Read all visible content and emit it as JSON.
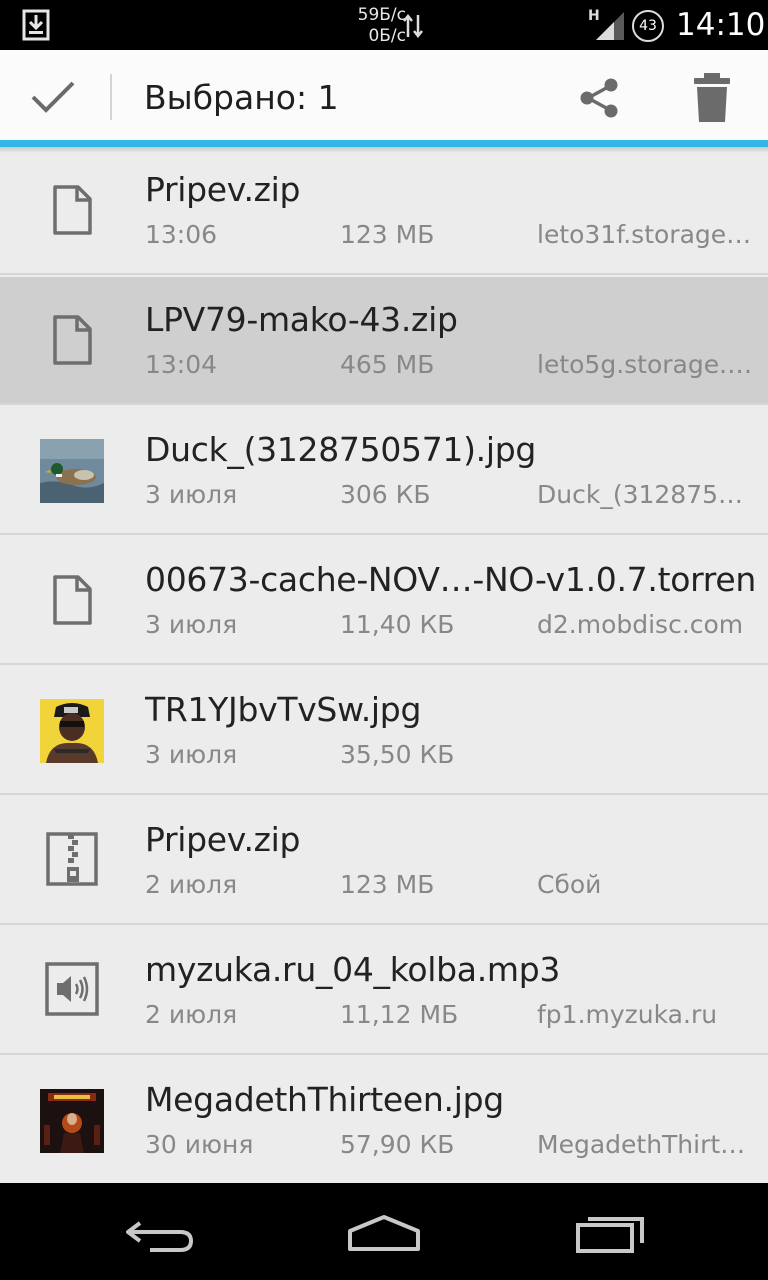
{
  "status_bar": {
    "speed_down": "59Б/с",
    "speed_up": "0Б/с",
    "network_type": "H",
    "battery": "43",
    "time": "14:10"
  },
  "action_bar": {
    "title": "Выбрано: 1",
    "done_icon": "check-icon",
    "share_icon": "share-icon",
    "delete_icon": "trash-icon",
    "accent_color": "#33b5e5"
  },
  "files": [
    {
      "name": "Pripev.zip",
      "date": "13:06",
      "size": "123 МБ",
      "source": "leto31f.storage…",
      "icon": "file-icon",
      "selected": false
    },
    {
      "name": "LPV79-mako-43.zip",
      "date": "13:04",
      "size": "465 МБ",
      "source": "leto5g.storage.…",
      "icon": "file-icon",
      "selected": true
    },
    {
      "name": "Duck_(3128750571).jpg",
      "date": "3 июля",
      "size": "306 КБ",
      "source": "Duck_(312875…",
      "icon": "duck-thumbnail",
      "selected": false
    },
    {
      "name": "00673-cache-NOV…-NO-v1.0.7.torrent",
      "date": "3 июля",
      "size": "11,40 КБ",
      "source": "d2.mobdisc.com",
      "icon": "file-icon",
      "selected": false
    },
    {
      "name": "TR1YJbvTvSw.jpg",
      "date": "3 июля",
      "size": "35,50 КБ",
      "source": "",
      "icon": "person-thumbnail",
      "selected": false
    },
    {
      "name": "Pripev.zip",
      "date": "2 июля",
      "size": "123 МБ",
      "source": "Сбой",
      "icon": "archive-icon",
      "selected": false
    },
    {
      "name": "myzuka.ru_04_kolba.mp3",
      "date": "2 июля",
      "size": "11,12 МБ",
      "source": "fp1.myzuka.ru",
      "icon": "audio-icon",
      "selected": false
    },
    {
      "name": "MegadethThirteen.jpg",
      "date": "30 июня",
      "size": "57,90 КБ",
      "source": "MegadethThirt…",
      "icon": "album-thumbnail",
      "selected": false
    }
  ],
  "nav_bar": {
    "back_icon": "back-icon",
    "home_icon": "home-icon",
    "recent_icon": "recent-apps-icon"
  }
}
